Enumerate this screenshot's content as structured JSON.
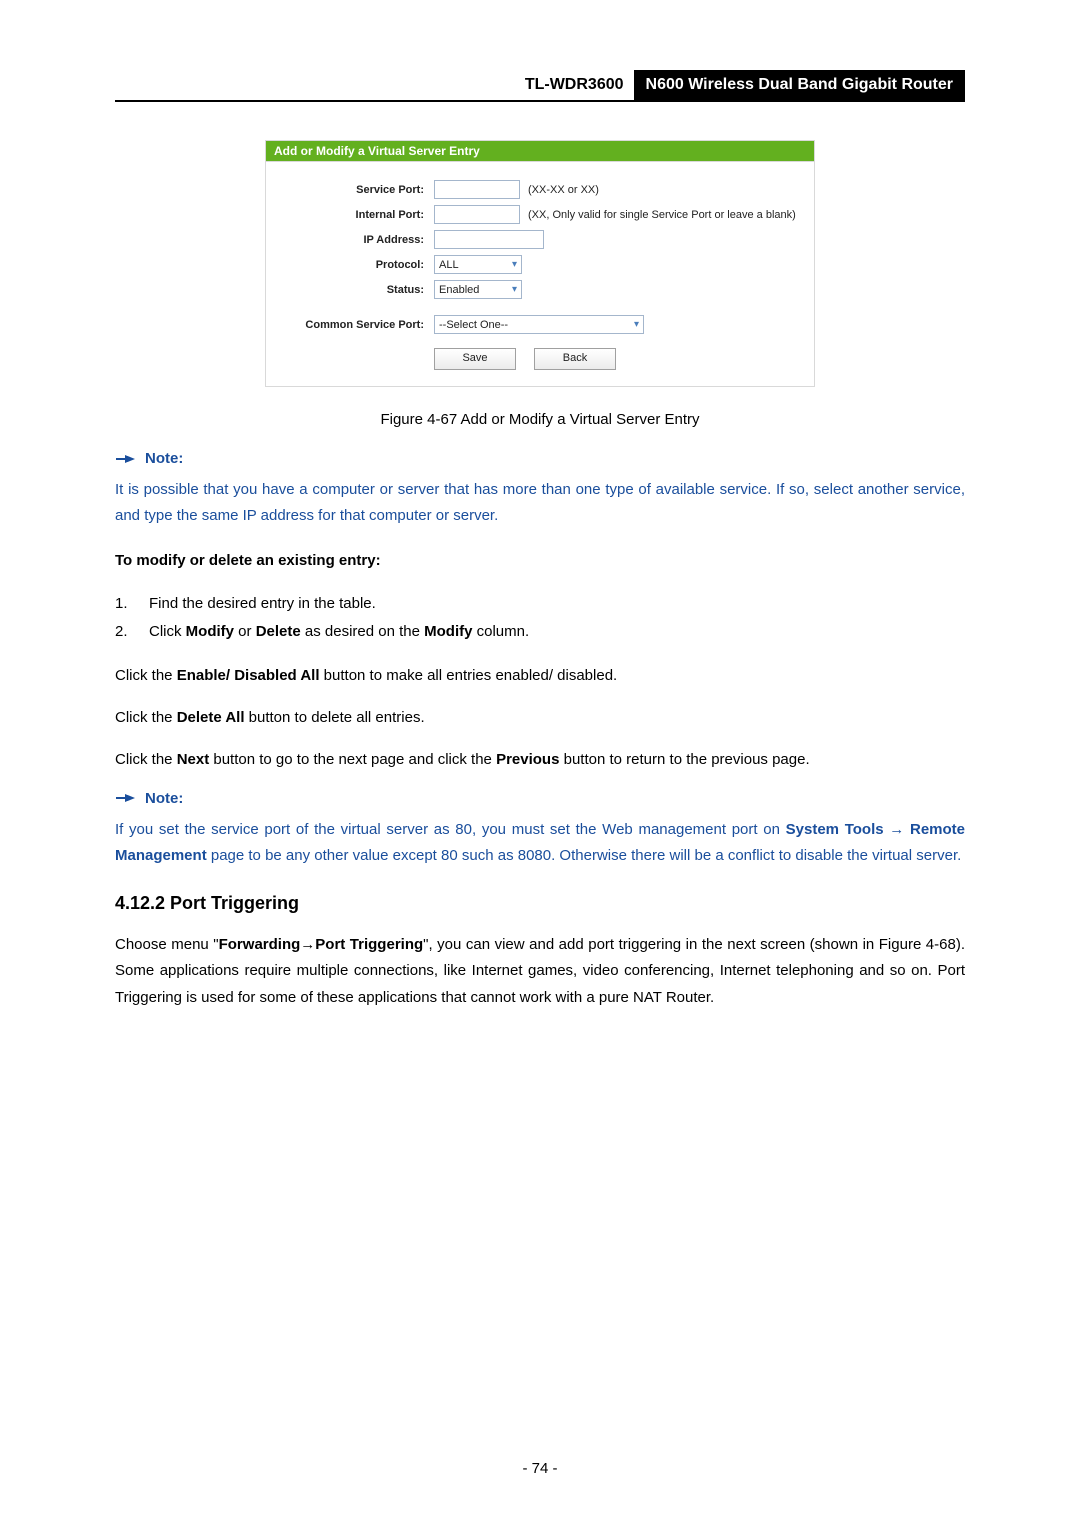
{
  "header": {
    "model": "TL-WDR3600",
    "title": "N600 Wireless Dual Band Gigabit Router"
  },
  "panel": {
    "title": "Add or Modify a Virtual Server Entry",
    "fields": {
      "service_port": {
        "label": "Service Port:",
        "hint": "(XX-XX or XX)"
      },
      "internal_port": {
        "label": "Internal Port:",
        "hint": "(XX, Only valid for single Service Port or leave a blank)"
      },
      "ip_address": {
        "label": "IP Address:"
      },
      "protocol": {
        "label": "Protocol:",
        "value": "ALL"
      },
      "status": {
        "label": "Status:",
        "value": "Enabled"
      },
      "common_service_port": {
        "label": "Common Service Port:",
        "value": "--Select One--"
      }
    },
    "buttons": {
      "save": "Save",
      "back": "Back"
    }
  },
  "figcap": "Figure 4-67 Add or Modify a Virtual Server Entry",
  "note_label": "Note:",
  "note1": "It is possible that you have a computer or server that has more than one type of available service. If so, select another service, and type the same IP address for that computer or server.",
  "modify_heading": "To modify or delete an existing entry:",
  "steps": {
    "s1": "Find the desired entry in the table.",
    "s2_prefix": "Click ",
    "s2_bold1": "Modify",
    "s2_mid": " or ",
    "s2_bold2": "Delete",
    "s2_mid2": " as desired on the ",
    "s2_bold3": "Modify",
    "s2_suffix": " column."
  },
  "p_enable": {
    "pre": "Click the ",
    "bold": "Enable/ Disabled All",
    "post": " button to make all entries enabled/ disabled."
  },
  "p_deleteall": {
    "pre": "Click the ",
    "bold": "Delete All",
    "post": " button to delete all entries."
  },
  "p_nextprev": {
    "pre": "Click the ",
    "b1": "Next",
    "mid": " button to go to the next page and click the ",
    "b2": "Previous",
    "post": " button to return to the previous page."
  },
  "note2": {
    "pre": "If you set the service port of the virtual server as 80, you must set the Web management port on ",
    "b1": "System Tools",
    "arrow": " → ",
    "b2": "Remote Management",
    "post": " page to be any other value except 80 such as 8080. Otherwise there will be a conflict to disable the virtual server."
  },
  "section_heading": "4.12.2  Port Triggering",
  "sec_para": {
    "pre": "Choose menu \"",
    "b1": "Forwarding",
    "arrow": "→",
    "b2": "Port Triggering",
    "post": "\", you can view and add port triggering in the next screen (shown in Figure 4-68). Some applications require multiple connections, like Internet games, video conferencing, Internet telephoning and so on. Port Triggering is used for some of these applications that cannot work with a pure NAT Router."
  },
  "pagenum": "- 74 -"
}
